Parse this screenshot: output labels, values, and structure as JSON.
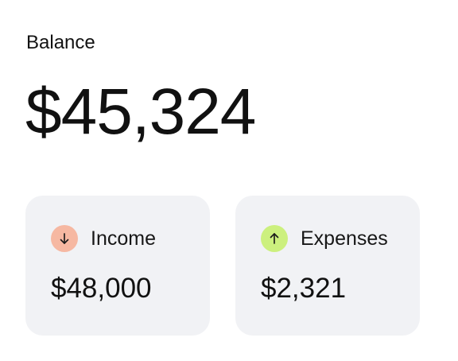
{
  "balance": {
    "label": "Balance",
    "amount": "$45,324"
  },
  "cards": [
    {
      "title": "Income",
      "value": "$48,000",
      "icon": "arrow-down-icon",
      "icon_color": "#F6B8A2",
      "card_color": "#F1F2F5"
    },
    {
      "title": "Expenses",
      "value": "$2,321",
      "icon": "arrow-up-icon",
      "icon_color": "#CCF07E",
      "card_color": "#F1F2F5"
    }
  ]
}
